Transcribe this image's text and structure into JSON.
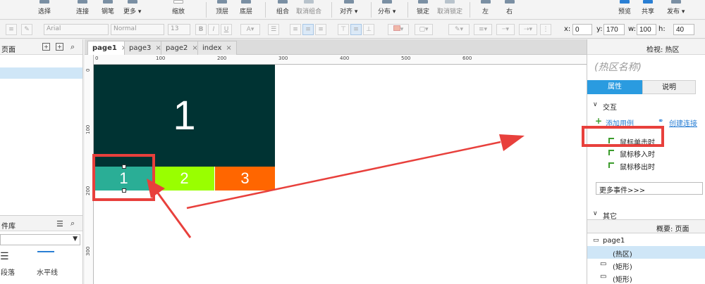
{
  "toolbar": {
    "items": [
      {
        "label": "选择"
      },
      {
        "label": "连接"
      },
      {
        "label": "钢笔"
      },
      {
        "label": "更多 ▾"
      },
      {
        "label": "缩放"
      },
      {
        "label": "顶层"
      },
      {
        "label": "底层"
      },
      {
        "label": "组合"
      },
      {
        "label": "取消组合"
      },
      {
        "label": "对齐 ▾"
      },
      {
        "label": "分布 ▾"
      },
      {
        "label": "锁定"
      },
      {
        "label": "取消锁定"
      },
      {
        "label": "左"
      },
      {
        "label": "右"
      },
      {
        "label": "预览"
      },
      {
        "label": "共享"
      },
      {
        "label": "发布 ▾"
      }
    ],
    "accent_share": "#2a7fd4"
  },
  "format": {
    "font_family": "Arial",
    "font_style": "Normal",
    "font_size": "13",
    "x_label": "x:",
    "x_value": "0",
    "y_label": "y:",
    "y_value": "170",
    "w_label": "w:",
    "w_value": "100",
    "h_label": "h:",
    "h_value": "40"
  },
  "left_pages": {
    "title": "页面"
  },
  "left_widgets": {
    "title": "件库",
    "items": [
      {
        "label": "段落"
      },
      {
        "label": "水平线"
      }
    ]
  },
  "tabs": [
    {
      "label": "page1",
      "close": "×",
      "active": true
    },
    {
      "label": "page3",
      "close": "×"
    },
    {
      "label": "page2",
      "close": "×"
    },
    {
      "label": "index",
      "close": "×"
    }
  ],
  "ruler": {
    "top": [
      "0",
      "100",
      "200",
      "300",
      "400",
      "500",
      "600"
    ],
    "left": [
      "0",
      "100",
      "200",
      "300"
    ]
  },
  "canvas": {
    "big_label": "1",
    "big_color": "#003333",
    "sub_boxes": [
      {
        "label": "1",
        "color": "#2aae96"
      },
      {
        "label": "2",
        "color": "#99ff00"
      },
      {
        "label": "3",
        "color": "#ff6600"
      }
    ],
    "highlight_color": "#e8403c"
  },
  "inspector": {
    "title": "检视: 热区",
    "name_placeholder": "(热区名称)",
    "tab_properties": "属性",
    "tab_notes": "说明",
    "section_interaction": "交互",
    "add_case": "添加用例",
    "create_link": "创建连接",
    "events": [
      {
        "label": "鼠标单击时"
      },
      {
        "label": "鼠标移入时"
      },
      {
        "label": "鼠标移出时"
      }
    ],
    "more_events": "更多事件>>>",
    "section_other": "其它",
    "outline_title": "概要: 页面",
    "outline": [
      {
        "label": "page1"
      },
      {
        "label": "(热区)"
      },
      {
        "label": "(矩形)"
      },
      {
        "label": "(矩形)"
      }
    ]
  }
}
